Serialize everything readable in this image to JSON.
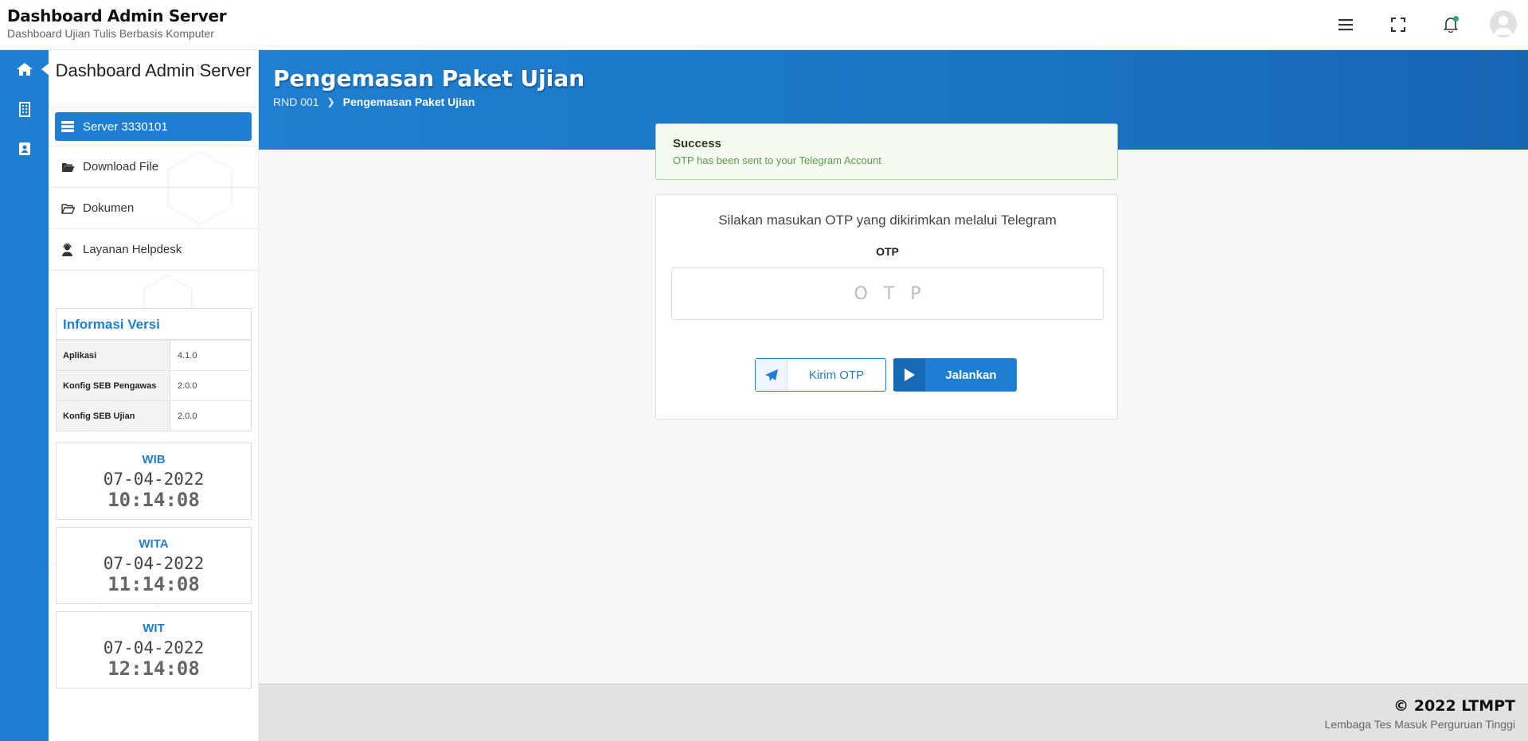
{
  "header": {
    "title": "Dashboard Admin Server",
    "subtitle": "Dashboard Ujian Tulis Berbasis Komputer"
  },
  "rail": {
    "items": [
      {
        "icon": "home-icon",
        "active": true
      },
      {
        "icon": "building-icon",
        "active": false
      },
      {
        "icon": "contact-book-icon",
        "active": false
      }
    ]
  },
  "sidebar": {
    "title": "Dashboard Admin Server",
    "items": [
      {
        "label": "Server 3330101",
        "icon": "server-icon",
        "active": true
      },
      {
        "label": "Download File",
        "icon": "folder-open-icon",
        "active": false
      },
      {
        "label": "Dokumen",
        "icon": "folder-outline-icon",
        "active": false
      },
      {
        "label": "Layanan Helpdesk",
        "icon": "user-headset-icon",
        "active": false
      }
    ],
    "version_info": {
      "title": "Informasi Versi",
      "rows": [
        {
          "key": "Aplikasi",
          "value": "4.1.0"
        },
        {
          "key": "Konfig SEB Pengawas",
          "value": "2.0.0"
        },
        {
          "key": "Konfig SEB Ujian",
          "value": "2.0.0"
        }
      ]
    },
    "clocks": [
      {
        "zone": "WIB",
        "date": "07-04-2022",
        "time": "10:14:08"
      },
      {
        "zone": "WITA",
        "date": "07-04-2022",
        "time": "11:14:08"
      },
      {
        "zone": "WIT",
        "date": "07-04-2022",
        "time": "12:14:08"
      }
    ]
  },
  "main": {
    "page_title": "Pengemasan Paket Ujian",
    "breadcrumb": {
      "parent": "RND 001",
      "current": "Pengemasan Paket Ujian"
    },
    "alert": {
      "title": "Success",
      "message": "OTP has been sent to your Telegram Account"
    },
    "otp_card": {
      "hint": "Silakan masukan OTP yang dikirimkan melalui Telegram",
      "label": "OTP",
      "placeholder": "OTP",
      "value": "",
      "send_button": "Kirim OTP",
      "run_button": "Jalankan"
    }
  },
  "footer": {
    "copyright": "© 2022 LTMPT",
    "organization": "Lembaga Tes Masuk Perguruan Tinggi"
  },
  "colors": {
    "primary": "#1e7fd2",
    "success_bg": "#f6fbf2",
    "success_border": "#a8d49b",
    "notification_dot": "#27ae60"
  }
}
